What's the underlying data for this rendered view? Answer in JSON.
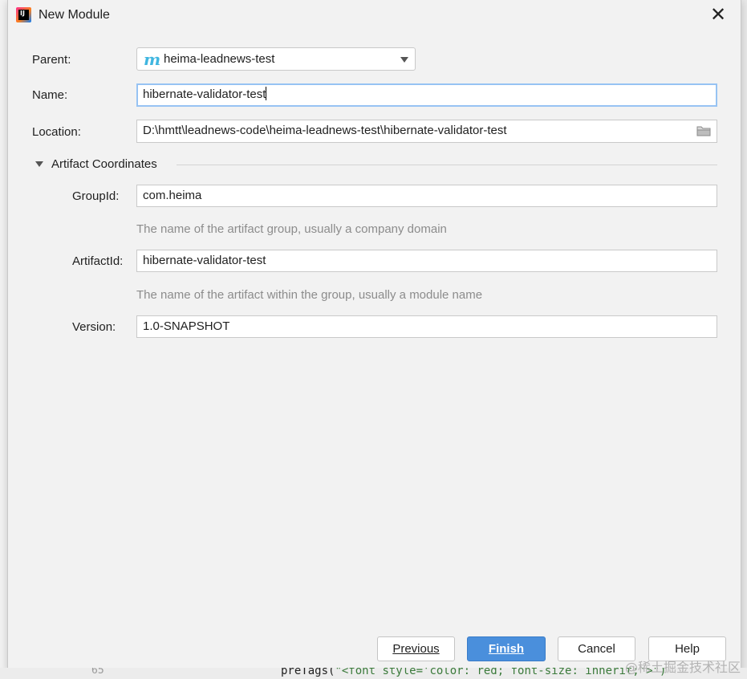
{
  "dialog": {
    "title": "New Module",
    "close_glyph": "✕"
  },
  "form": {
    "parent_label": "Parent:",
    "parent_value": "heima-leadnews-test",
    "parent_icon_glyph": "m",
    "name_label": "Name:",
    "name_value": "hibernate-validator-test",
    "location_label": "Location:",
    "location_value": "D:\\hmtt\\leadnews-code\\heima-leadnews-test\\hibernate-validator-test"
  },
  "artifact": {
    "section_title": "Artifact Coordinates",
    "groupid_label": "GroupId:",
    "groupid_value": "com.heima",
    "groupid_hint": "The name of the artifact group, usually a company domain",
    "artifactid_label": "ArtifactId:",
    "artifactid_value": "hibernate-validator-test",
    "artifactid_hint": "The name of the artifact within the group, usually a module name",
    "version_label": "Version:",
    "version_value": "1.0-SNAPSHOT"
  },
  "buttons": {
    "previous": "Previous",
    "finish": "Finish",
    "cancel": "Cancel",
    "help": "Help"
  },
  "background": {
    "line_number": "65",
    "code_prefix": "preTags(",
    "code_string": "\"<font style='color: red; font-size: inherit;'>\")",
    "watermark": "@稀土掘金技术社区"
  },
  "colors": {
    "primary_button": "#4a8fdc",
    "focus_border": "#97c3f3",
    "hint_text": "#8c8c8c",
    "maven_icon": "#40b6e0"
  }
}
